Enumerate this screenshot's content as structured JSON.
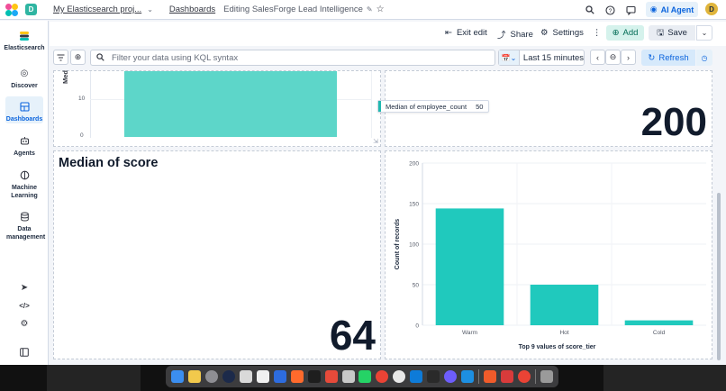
{
  "header": {
    "space_initial": "D",
    "project_label": "My Elasticsearch proj...",
    "dashboards_link": "Dashboards",
    "editing_title": "Editing SalesForge Lead Intelligence",
    "ai_agent_label": "AI Agent",
    "user_initial": "D"
  },
  "sidebar": {
    "items": [
      {
        "label": "Elasticsearch",
        "icon": "elastic-logo-icon"
      },
      {
        "label": "Discover",
        "icon": "compass-icon"
      },
      {
        "label": "Dashboards",
        "icon": "dashboard-icon",
        "active": true
      },
      {
        "label": "Agents",
        "icon": "robot-icon"
      },
      {
        "label": "Machine Learning",
        "icon": "ml-icon"
      },
      {
        "label": "Data management",
        "icon": "database-icon"
      }
    ],
    "bottom_icons": [
      "rocket-icon",
      "code-icon",
      "gear-icon",
      "collapse-panel-icon"
    ]
  },
  "toolbar": {
    "exit_edit_label": "Exit edit",
    "share_label": "Share",
    "settings_label": "Settings",
    "add_label": "Add",
    "save_label": "Save"
  },
  "querybar": {
    "search_placeholder": "Filter your data using KQL syntax",
    "time_range_label": "Last 15 minutes",
    "refresh_label": "Refresh"
  },
  "panels": {
    "top_left": {
      "ylabel_fragment": "Med",
      "tick_10": "10",
      "tick_0": "0"
    },
    "top_right": {
      "tooltip_label": "Median of employee_count",
      "tooltip_value": "50",
      "metric_value": "200"
    },
    "bottom_left": {
      "title": "Median of score",
      "metric_value": "64"
    }
  },
  "colors": {
    "bar": "#20c9bd",
    "accent": "#0b64dd"
  },
  "chart_data": {
    "type": "bar",
    "categories": [
      "Warm",
      "Hot",
      "Cold"
    ],
    "values": [
      144,
      50,
      6
    ],
    "xlabel": "Top 9 values of score_tier",
    "ylabel": "Count of records",
    "ylim": [
      0,
      200
    ],
    "yticks": [
      0,
      50,
      100,
      150,
      200
    ],
    "grid": true
  }
}
